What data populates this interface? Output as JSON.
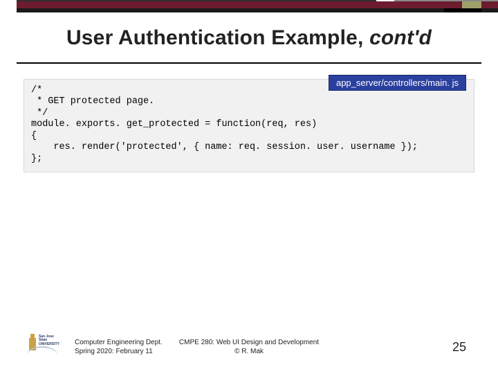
{
  "title": {
    "text": "User Authentication Example, ",
    "contd": "cont'd"
  },
  "file_label": "app_server/controllers/main. js",
  "code": "/*\n * GET protected page.\n */\nmodule. exports. get_protected = function(req, res)\n{\n    res. render('protected', { name: req. session. user. username });\n};",
  "footer": {
    "left_line1": "Computer Engineering Dept.",
    "left_line2": "Spring 2020: February 11",
    "center_line1": "CMPE 280: Web UI Design and Development",
    "center_line2": "© R. Mak",
    "page": "25"
  },
  "logo": {
    "uni": "San Jose State",
    "tag": "UNIVERSITY"
  }
}
